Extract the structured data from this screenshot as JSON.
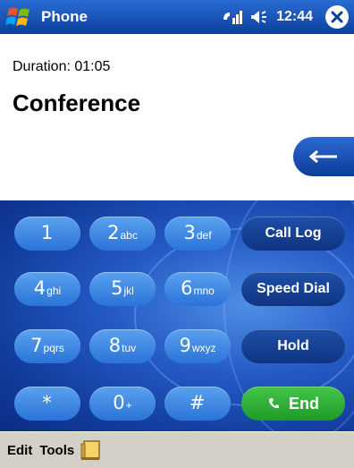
{
  "titlebar": {
    "app_title": "Phone",
    "clock": "12:44",
    "icons": {
      "start": "windows-flag-icon",
      "signal": "phone-signal-icon",
      "volume": "speaker-icon",
      "close": "close-icon"
    }
  },
  "call": {
    "duration": "Duration: 01:05",
    "status": "Conference"
  },
  "keypad": {
    "keys": [
      {
        "digit": "1",
        "letters": ""
      },
      {
        "digit": "2",
        "letters": "abc"
      },
      {
        "digit": "3",
        "letters": "def"
      },
      {
        "digit": "4",
        "letters": "ghi"
      },
      {
        "digit": "5",
        "letters": "jkl"
      },
      {
        "digit": "6",
        "letters": "mno"
      },
      {
        "digit": "7",
        "letters": "pqrs"
      },
      {
        "digit": "8",
        "letters": "tuv"
      },
      {
        "digit": "9",
        "letters": "wxyz"
      },
      {
        "digit": "*",
        "letters": ""
      },
      {
        "digit": "0",
        "letters": "+"
      },
      {
        "digit": "#",
        "letters": ""
      }
    ],
    "call_log": "Call Log",
    "speed_dial": "Speed Dial",
    "hold": "Hold",
    "end": "End"
  },
  "menubar": {
    "edit": "Edit",
    "tools": "Tools"
  },
  "colors": {
    "titlebar": "#0b3f9e",
    "key": "#3b83e0",
    "function_key": "#123c92",
    "end_key": "#2aa832",
    "menubar": "#d4d0c8"
  }
}
